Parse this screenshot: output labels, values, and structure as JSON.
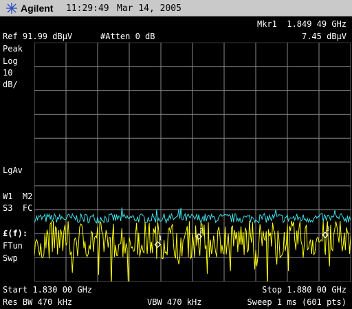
{
  "titlebar": {
    "brand": "Agilent",
    "time": "11:29:49",
    "date": "Mar 14, 2005"
  },
  "header": {
    "marker_label": "Mkr1",
    "marker_freq": "1.849 49 GHz",
    "ref_level": "Ref 91.99 dBµV",
    "atten": "#Atten 0 dB",
    "marker_amp": "7.45 dBµV"
  },
  "sidebar": {
    "detector": "Peak",
    "scale_type": "Log",
    "scale_value": "10",
    "scale_unit": "dB/",
    "avg_type": "LgAv",
    "w1m2": "W1  M2",
    "s3fc": "S3  FC",
    "ff": "£(f):",
    "ftun": "FTun",
    "swp": "Swp"
  },
  "footer": {
    "start": "Start 1.830 00 GHz",
    "stop": "Stop 1.880 00 GHz",
    "res_bw": "Res BW 470 kHz",
    "vbw": "VBW 470 kHz",
    "sweep": "Sweep 1 ms (601 pts)"
  },
  "markers": [
    "1",
    "2",
    "3"
  ],
  "colors": {
    "trace_yellow": "#ffff00",
    "trace_cyan": "#40e0e8",
    "grid": "#8a8a8a",
    "background": "#000000",
    "titlebar": "#c9c9c9"
  },
  "chart_data": {
    "type": "line",
    "x_range_ghz": [
      1.83,
      1.88
    ],
    "y_range_dbuv": [
      -8.01,
      91.99
    ],
    "grid": true,
    "grid_divisions": {
      "x": 10,
      "y": 10
    },
    "series": [
      {
        "color": "#40e0e8",
        "level_dbuv": 18.5,
        "jitter_db": 2.0
      },
      {
        "color": "#ffff00",
        "level_dbuv": 9.5,
        "jitter_db": 8.0
      }
    ],
    "markers": [
      {
        "label": "1",
        "freq_ghz": 1.84949,
        "amp_dbuv": 7.45
      },
      {
        "label": "2",
        "freq_ghz": 1.856,
        "amp_dbuv": 10.8
      },
      {
        "label": "3",
        "freq_ghz": 1.876,
        "amp_dbuv": 11.5
      }
    ]
  }
}
